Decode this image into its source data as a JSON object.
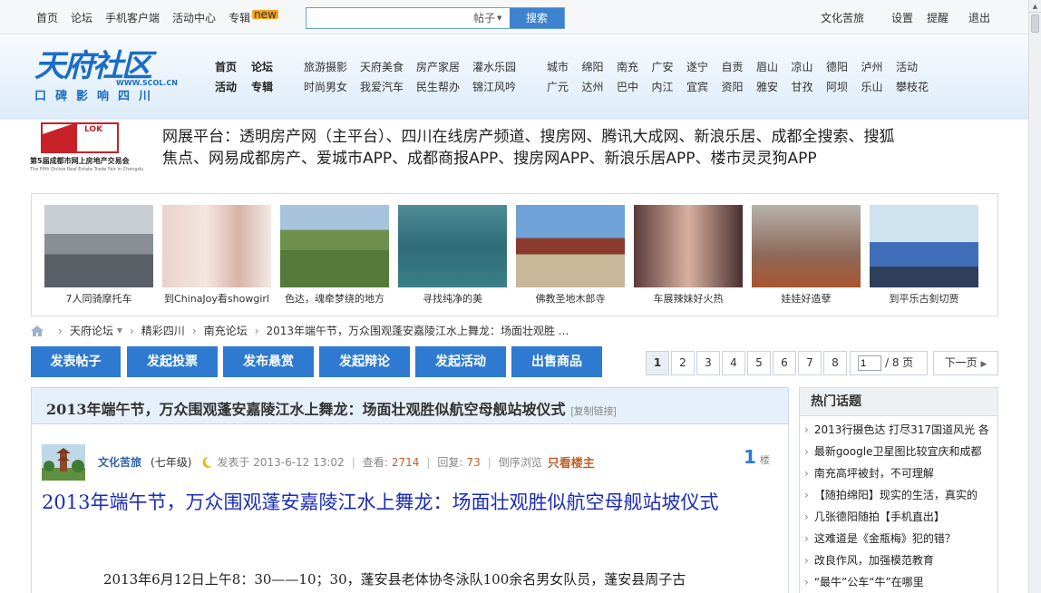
{
  "topbar": {
    "links": [
      "首页",
      "论坛",
      "手机客户端",
      "活动中心",
      "专辑"
    ],
    "new_badge": "new",
    "search_placeholder": "",
    "search_scope": "帖子",
    "search_button": "搜索",
    "user": "文化苦旅",
    "settings": "设置",
    "remind": "提醒",
    "logout": "退出"
  },
  "header": {
    "logo_main": "天府社区",
    "logo_url": "WWW.SCOL.CN",
    "logo_slogan": "口碑影响四川",
    "nav_main_row1": [
      "首页",
      "论坛"
    ],
    "nav_main_row2": [
      "活动",
      "专辑"
    ],
    "nav_topics_row1": [
      "旅游摄影",
      "天府美食",
      "房产家居",
      "灌水乐园"
    ],
    "nav_topics_row2": [
      "时尚男女",
      "我爱汽车",
      "民生帮办",
      "锦江风吟"
    ],
    "nav_cities_row1": [
      "城市",
      "绵阳",
      "南充",
      "广安",
      "遂宁",
      "自贡",
      "眉山",
      "凉山",
      "德阳",
      "泸州",
      "活动"
    ],
    "nav_cities_row2": [
      "广元",
      "达州",
      "巴中",
      "内江",
      "宜宾",
      "资阳",
      "雅安",
      "甘孜",
      "阿坝",
      "乐山",
      "攀枝花"
    ]
  },
  "banner": {
    "logo_label": "LOK",
    "caption": "第5届成都市网上房地产交易会",
    "caption_en": "The Fifth Online Real Estate Trade Fair in Chengdu",
    "text": "网展平台：透明房产网（主平台）、四川在线房产频道、搜房网、腾讯大成网、新浪乐居、成都全搜索、搜狐焦点、网易成都房产、爱城市APP、成都商报APP、搜房网APP、新浪乐居APP、楼市灵灵狗APP"
  },
  "photos": [
    {
      "caption": "7人同骑摩托车"
    },
    {
      "caption": "到ChinaJoy看showgirl"
    },
    {
      "caption": "色达，魂牵梦绕的地方"
    },
    {
      "caption": "寻找纯净的美"
    },
    {
      "caption": "佛教圣地木郎寺"
    },
    {
      "caption": "车展辣妹好火热"
    },
    {
      "caption": "娃娃好造孽"
    },
    {
      "caption": "到平乐古釗切贾"
    }
  ],
  "breadcrumb": {
    "forum": "天府论坛",
    "section": "精彩四川",
    "board": "南充论坛",
    "thread": "2013年端午节，万众围观蓬安嘉陵江水上舞龙：场面壮观胜 ..."
  },
  "actions": [
    "发表帖子",
    "发起投票",
    "发布悬赏",
    "发起辩论",
    "发起活动",
    "出售商品"
  ],
  "pager": {
    "pages": [
      "1",
      "2",
      "3",
      "4",
      "5",
      "6",
      "7",
      "8"
    ],
    "current": "1",
    "jump_value": "1",
    "total": "/ 8 页",
    "next": "下一页"
  },
  "post": {
    "header_title": "2013年端午节，万众围观蓬安嘉陵江水上舞龙：场面壮观胜似航空母舰站坡仪式",
    "copy_link": "[复制链接]",
    "author": "文化苦旅",
    "level": "(七年级)",
    "posted_at": "发表于 2013-6-12 13:02",
    "views_label": "查看:",
    "views": "2714",
    "replies_label": "回复:",
    "replies": "73",
    "reverse": "倒序浏览",
    "only_op": "只看楼主",
    "floor_num": "1",
    "floor_label": "楼",
    "title": "2013年端午节，万众围观蓬安嘉陵江水上舞龙：场面壮观胜似航空母舰站坡仪式",
    "first_line": "2013年6月12日上午8：30——10；30，蓬安县老体协冬泳队100余名男女队员，蓬安县周子古"
  },
  "sidebar": {
    "heading": "热门话题",
    "items": [
      "2013行摄色达 打尽317国道风光 各",
      "最新google卫星图比较宜庆和成都",
      "南充高坪被封，不可理解",
      "【随拍绵阳】现实的生活，真实的",
      "几张德阳随拍【手机直出】",
      "这难道是《金瓶梅》犯的错？",
      "改良作风，加强模范教育",
      "“最牛”公车“牛”在哪里"
    ]
  },
  "colors": {
    "accent": "#2e7ad0",
    "title_blue": "#1a2cb8",
    "highlight": "#c0602a"
  }
}
